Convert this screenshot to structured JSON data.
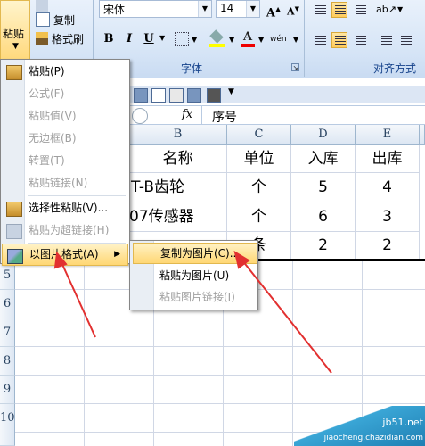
{
  "ribbon": {
    "paste_label": "粘贴",
    "copy_label": "复制",
    "format_painter_label": "格式刷",
    "font_name": "宋体",
    "font_size": "14",
    "bold": "B",
    "italic": "I",
    "underline": "U",
    "phonetic": "wén",
    "font_group_label": "字体",
    "align_group_label": "对齐方式"
  },
  "formula_bar": {
    "fx": "fx",
    "value": "序号"
  },
  "columns": [
    "B",
    "C",
    "D",
    "E"
  ],
  "rows": [
    {
      "num": "",
      "cells": [
        "名称",
        "单位",
        "入库",
        "出库"
      ]
    },
    {
      "num": "",
      "cells": [
        "T-B齿轮",
        "个",
        "5",
        "4"
      ]
    },
    {
      "num": "",
      "cells": [
        "07传感器",
        "个",
        "6",
        "3"
      ]
    },
    {
      "num": "",
      "cells": [
        "",
        "条",
        "2",
        "2"
      ]
    }
  ],
  "row_numbers": [
    "5",
    "6",
    "7",
    "8",
    "9",
    "10"
  ],
  "context_menu": {
    "items": [
      {
        "label": "粘贴(P)",
        "disabled": false
      },
      {
        "label": "公式(F)",
        "disabled": true
      },
      {
        "label": "粘贴值(V)",
        "disabled": true
      },
      {
        "label": "无边框(B)",
        "disabled": true
      },
      {
        "label": "转置(T)",
        "disabled": true
      },
      {
        "label": "粘贴链接(N)",
        "disabled": true
      },
      {
        "label": "选择性粘贴(V)...",
        "disabled": false
      },
      {
        "label": "粘贴为超链接(H)",
        "disabled": true
      },
      {
        "label": "以图片格式(A)",
        "disabled": false
      }
    ]
  },
  "submenu": {
    "items": [
      {
        "label": "复制为图片(C)...",
        "disabled": false
      },
      {
        "label": "粘贴为图片(U)",
        "disabled": false
      },
      {
        "label": "粘贴图片链接(I)",
        "disabled": true
      }
    ]
  },
  "watermark": {
    "line1": "jb51.net",
    "line2": "jiaocheng.chazidian.com"
  },
  "accent": "#e23030"
}
